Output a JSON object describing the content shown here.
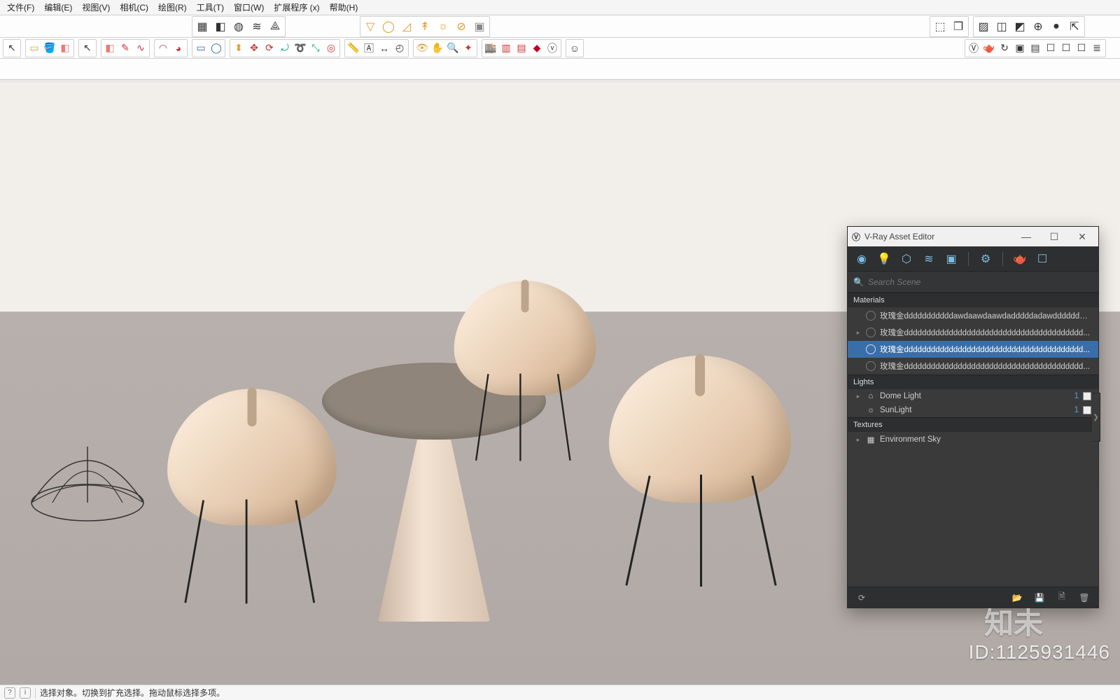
{
  "menu": {
    "items": [
      "文件(F)",
      "编辑(E)",
      "视图(V)",
      "相机(C)",
      "绘图(R)",
      "工具(T)",
      "窗口(W)",
      "扩展程序 (x)",
      "帮助(H)"
    ]
  },
  "toolbar1": {
    "left_group": [
      "select",
      "cube",
      "cyl",
      "wave",
      "net"
    ],
    "mid_group": [
      "hat",
      "circle",
      "arc",
      "height",
      "sun",
      "donut",
      "box3d"
    ]
  },
  "toolbar2": {
    "g0": [
      "arrow"
    ],
    "g1": [
      "cube",
      "paint",
      "erase"
    ],
    "g2": [
      "arrow"
    ],
    "g3": [
      "erase",
      "pencil",
      "arc-red"
    ],
    "g4": [
      "arc-open",
      "poly-sel"
    ],
    "g5": [
      "rect",
      "circle-blue"
    ],
    "g6": [
      "push",
      "move-red",
      "rotate-red",
      "rotate-grn",
      "follow",
      "scale",
      "offset"
    ],
    "g7": [
      "tape",
      "label",
      "zoom",
      "protractor"
    ],
    "g8": [
      "eye",
      "hand",
      "magnify",
      "orbit"
    ],
    "g9": [
      "3dwh",
      "red-box",
      "tag",
      "ruby",
      "v"
    ],
    "g10": [
      "person"
    ],
    "right_a": [
      "cube-add",
      "cube-edit"
    ],
    "right_b": [
      "sel",
      "cube",
      "cube2",
      "globe",
      "ball",
      "box"
    ],
    "vray_row1": [
      "v-logo",
      "teapot",
      "teapot-spin",
      "frame",
      "frame2",
      "win",
      "win2",
      "win3",
      "stack"
    ]
  },
  "vray": {
    "title": "V-Ray Asset Editor",
    "win_controls": [
      "min",
      "max",
      "close"
    ],
    "tabs": [
      "materials",
      "lights",
      "geom",
      "layers",
      "render",
      "settings",
      "teapot",
      "frame"
    ],
    "search_placeholder": "Search Scene",
    "sections": {
      "materials_header": "Materials",
      "materials": [
        "玫瑰金dddddddddddawdaawdaawdadddddadawdddddddd...",
        "玫瑰金dddddddddddddddddddddddddddddddddddddddd...",
        "玫瑰金dddddddddddddddddddddddddddddddddddddddd...",
        "玫瑰金dddddddddddddddddddddddddddddddddddddddd..."
      ],
      "materials_selected_index": 2,
      "lights_header": "Lights",
      "lights": [
        {
          "name": "Dome Light",
          "count": "1"
        },
        {
          "name": "SunLight",
          "count": "1"
        }
      ],
      "textures_header": "Textures",
      "textures": [
        {
          "name": "Environment Sky"
        }
      ]
    },
    "footer_icons": [
      "refresh",
      "open",
      "save",
      "save2",
      "trash"
    ]
  },
  "status": {
    "icons": [
      "i1",
      "i2"
    ],
    "text": "选择对象。切换到扩充选择。拖动鼠标选择多项。"
  },
  "watermark": {
    "brand": "知未",
    "id_label": "ID:1125931446"
  }
}
